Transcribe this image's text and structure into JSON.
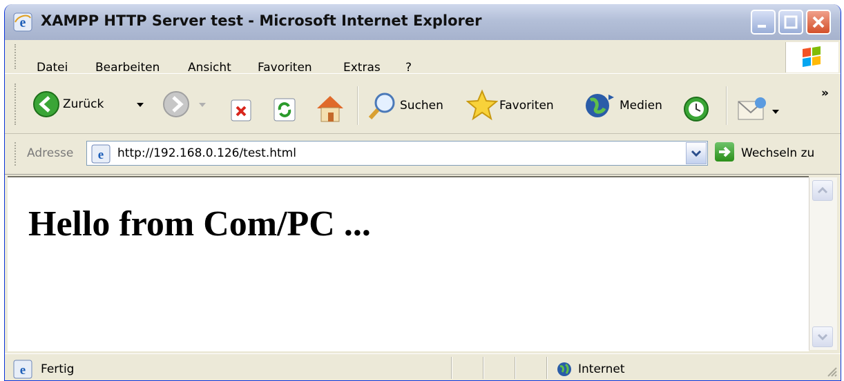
{
  "window": {
    "title": "XAMPP HTTP Server test - Microsoft Internet Explorer",
    "icon": "ie-icon",
    "controls": [
      "minimize-icon",
      "maximize-icon",
      "close-icon"
    ]
  },
  "menu": {
    "items": [
      {
        "label": "Datei"
      },
      {
        "label": "Bearbeiten"
      },
      {
        "label": "Ansicht"
      },
      {
        "label": "Favoriten"
      },
      {
        "label": "Extras"
      },
      {
        "label": "?"
      }
    ]
  },
  "toolbar": {
    "back_label": "Zurück",
    "search_label": "Suchen",
    "favorites_label": "Favoriten",
    "media_label": "Medien",
    "overflow": "»"
  },
  "address": {
    "label": "Adresse",
    "url": "http://192.168.0.126/test.html",
    "go_label": "Wechseln zu"
  },
  "page": {
    "heading": "Hello from Com/PC ..."
  },
  "status": {
    "text": "Fertig",
    "zone": "Internet"
  },
  "colors": {
    "titlebar": "#b3bfd8",
    "chrome": "#ece9d8",
    "close": "#d3502a",
    "link_blue": "#0831d9"
  }
}
